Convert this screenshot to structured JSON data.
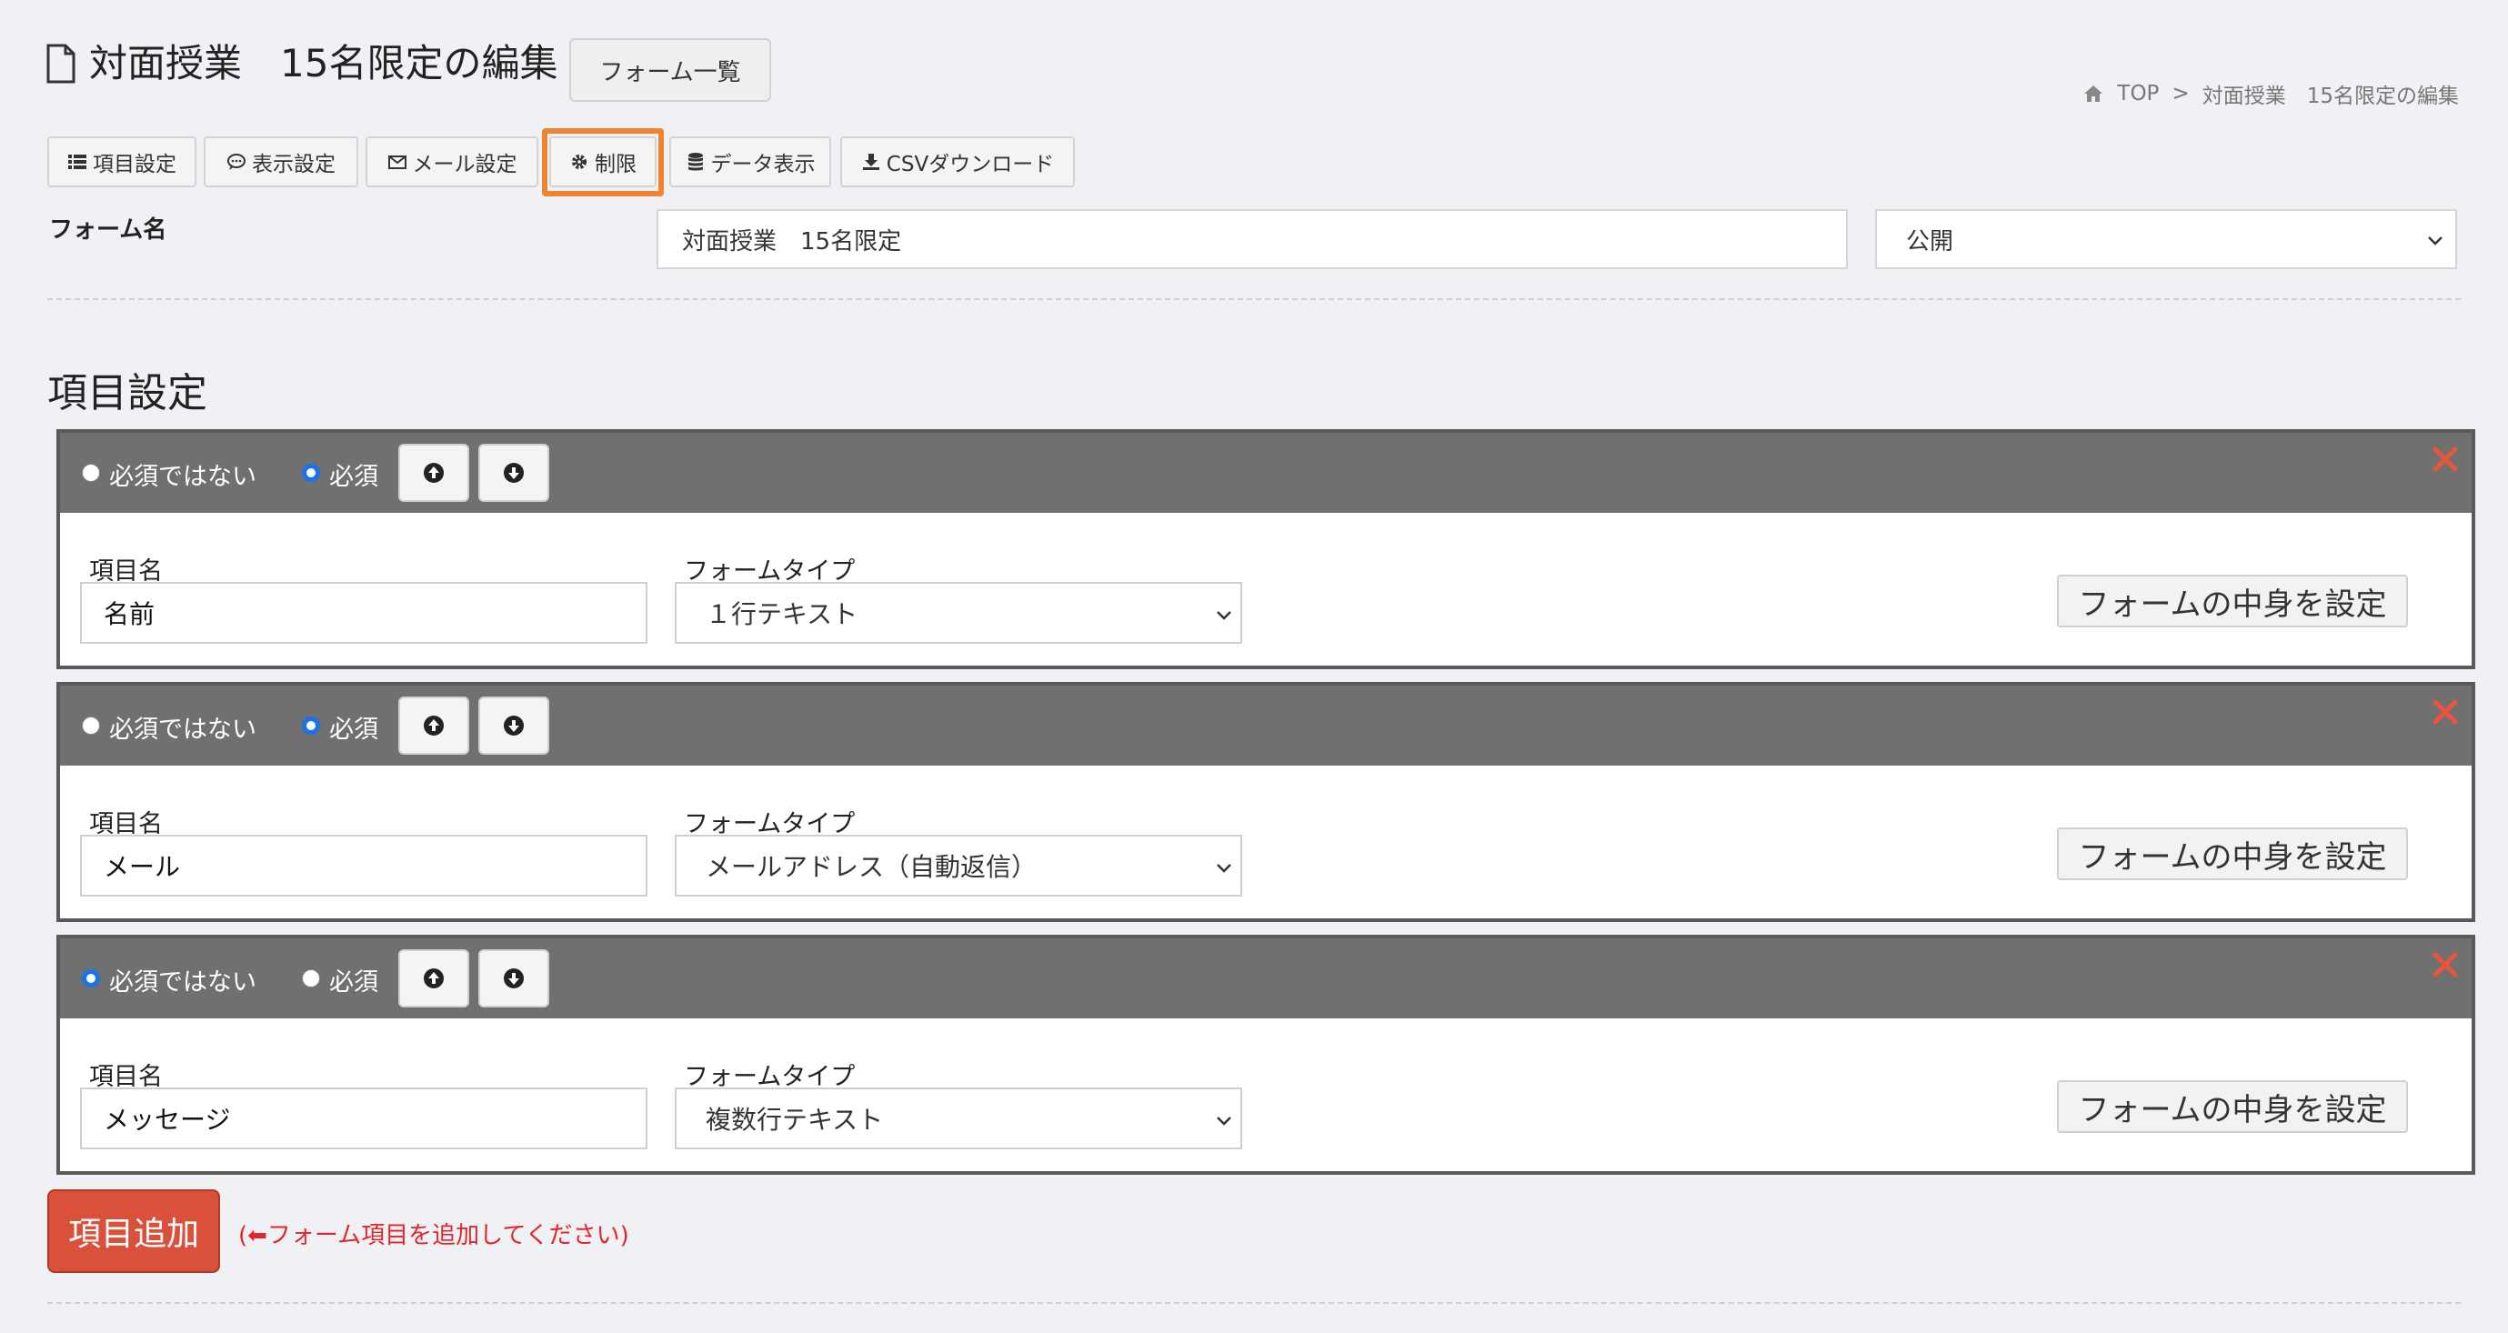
{
  "header": {
    "title": "対面授業　15名限定の編集",
    "form_list_button": "フォーム一覧"
  },
  "breadcrumb": {
    "home": "TOP",
    "separator": ">",
    "current": "対面授業　15名限定の編集"
  },
  "toolbar": {
    "items": [
      {
        "label": "項目設定",
        "icon": "list-icon"
      },
      {
        "label": "表示設定",
        "icon": "comment-icon"
      },
      {
        "label": "メール設定",
        "icon": "envelope-icon"
      },
      {
        "label": "制限",
        "icon": "gear-icon"
      },
      {
        "label": "データ表示",
        "icon": "database-icon"
      },
      {
        "label": "CSVダウンロード",
        "icon": "download-icon"
      }
    ],
    "highlighted": "制限",
    "highlight_color": "#f0832f"
  },
  "form_name": {
    "label": "フォーム名",
    "value": "対面授業　15名限定",
    "status": "公開"
  },
  "section_title": "項目設定",
  "item_labels": {
    "not_required": "必須ではない",
    "required": "必須",
    "name_label": "項目名",
    "type_label": "フォームタイプ",
    "content_button": "フォームの中身を設定"
  },
  "items": [
    {
      "name": "名前",
      "type": "１行テキスト",
      "required": true
    },
    {
      "name": "メール",
      "type": "メールアドレス（自動返信）",
      "required": true
    },
    {
      "name": "メッセージ",
      "type": "複数行テキスト",
      "required": false
    }
  ],
  "add_button": "項目追加",
  "add_hint": "(⬅フォーム項目を追加してください)",
  "colors": {
    "item_header": "#707070",
    "add_button": "#d9503b",
    "hint": "#e0262a",
    "delete": "#e8553a"
  }
}
